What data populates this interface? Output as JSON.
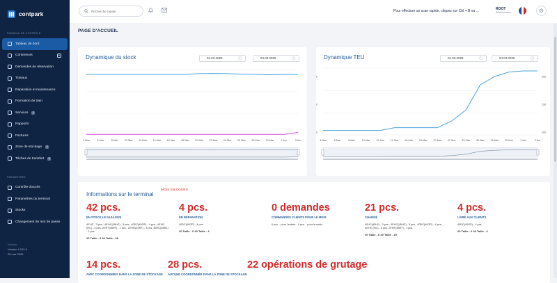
{
  "app": {
    "name": "contpark"
  },
  "sidebar": {
    "section1": "PANNEAU DE CONTRÔLE",
    "items": [
      {
        "label": "Tableau de bord",
        "active": true
      },
      {
        "label": "Conteneurs",
        "plus": true
      },
      {
        "label": "Demandes de réservation"
      },
      {
        "label": "Travaux"
      },
      {
        "label": "Réparation et maintenance"
      },
      {
        "label": "Formation de train"
      },
      {
        "label": "Services",
        "badge": "2"
      },
      {
        "label": "Rapports"
      },
      {
        "label": "Factures"
      },
      {
        "label": "Zone de stockage",
        "badge": "2"
      },
      {
        "label": "Tâches de transfert",
        "badge": "0"
      }
    ],
    "section2": "PARAMÈTRES",
    "settings_items": [
      {
        "label": "Contrôle d'accès"
      },
      {
        "label": "Paramètres du terminal"
      },
      {
        "label": "Stocks"
      },
      {
        "label": "Changement de mot de passe"
      }
    ],
    "footer": {
      "label": "Version",
      "version": "Version 4.102.9",
      "date": "28 mar 2025"
    }
  },
  "topbar": {
    "search_placeholder": "Recherche rapide",
    "notice": "Pour effectuer un scan rapide, cliquez sur Ctrl + B ou ...",
    "user_name": "ROOT",
    "user_role": "Administrateur"
  },
  "page": {
    "title": "PAGE D'ACCUEIL"
  },
  "stock_chart": {
    "title": "Dynamique du stock",
    "date_from": "04.03.2025",
    "date_to": "04.04.2025"
  },
  "teu_chart": {
    "title": "Dynamique TEU",
    "date_from": "04.03.2025",
    "date_to": "04.04.2025"
  },
  "chart_data": [
    {
      "type": "line",
      "title": "Dynamique du stock",
      "x": [
        "4 Mar",
        "6 Mar",
        "8 Mar",
        "10 Mar",
        "12 Mar",
        "14 Mar",
        "16 Mar",
        "18 Mar",
        "20 Mar",
        "22 Mar",
        "24 Mar",
        "26 Mar",
        "28 Mar",
        "30 Mar",
        "1 Avr",
        "3 Avr"
      ],
      "series": [
        {
          "values": [
            37,
            37,
            37,
            37,
            37,
            37,
            37,
            37,
            37.5,
            37.6,
            37.5,
            37.2,
            37,
            36.8,
            37,
            36.9
          ],
          "color": "#4ba3d9"
        },
        {
          "values": [
            0.3,
            0.3,
            0.3,
            0.3,
            0.3,
            0.3,
            0.3,
            0.3,
            0.3,
            0.3,
            0.3,
            0.3,
            0.3,
            0.3,
            0.3,
            1.5
          ],
          "color": "#d64fd2"
        }
      ]
    },
    {
      "type": "line",
      "title": "Dynamique TEU",
      "x": [
        "4 Mar",
        "6 Mar",
        "8 Mar",
        "10 Mar",
        "12 Mar",
        "14 Mar",
        "16 Mar",
        "18 Mar",
        "20 Mar",
        "22 Mar",
        "24 Mar",
        "26 Mar",
        "28 Mar",
        "30 Mar",
        "1 Avr",
        "3 Avr"
      ],
      "y_ticks": [
        "100",
        "150",
        "200"
      ],
      "series": [
        {
          "values": [
            103,
            103,
            103,
            103,
            103,
            108,
            108,
            108,
            108,
            120,
            140,
            185,
            200,
            208,
            210,
            210
          ],
          "color": "#4ba3d9"
        }
      ]
    }
  ],
  "info": {
    "title": "Informations sur le terminal",
    "subtitle": "MOIS EN COURS",
    "stats": [
      {
        "value": "42 pcs.",
        "label": "EN STOCK LE 04.04.2025",
        "detail": "40'HC - 3 pcs., 40'HC(45HC) - 3 pcs., 40DC(40GP) - 4 pcs., 40'HC (HC) - 4 pcs. 20'RT(45RT) - 1 pcs., 20'RE(22RT) - 3 pcs. 45HC(45R1) - 1 pcs.",
        "foot": "20 Taille - 6   40 Taille - 36"
      },
      {
        "value": "4 pcs.",
        "label": "EN RÉPARATION",
        "detail": "40DC(40GP) - 4 pcs.",
        "foot": "20 Taille - 0   40 Taille - 4"
      },
      {
        "value": "0 demandes",
        "label": "COMMANDES CLIENTS POUR LE MOIS",
        "detail": "0 pcs. - pour l'entrée · 0 pcs. - pour la sortie",
        "foot": ""
      },
      {
        "value": "21 pcs.",
        "label": "CHARGÉ",
        "detail": "40HC(45H1) - 3 pcs., 40'HC(45HC) - 3 pcs., 40DC(40GP) - 4 pcs., 40'HC (HC) - 4 pcs. 20'RT(45RT) - 1 pcs.",
        "foot": "20 Taille - 6   40 Taille - 15"
      },
      {
        "value": "4 pcs.",
        "label": "LIVRÉ AUX CLIENTS",
        "detail": "40DC(40GP) - 4 pcs.",
        "foot": "20 Taille - 0   40 Taille - 4"
      },
      {
        "value": "14 pcs.",
        "label": "AVEC COORDONNÉES DANS LA ZONE DE STOCKAGE",
        "detail": "",
        "foot": ""
      },
      {
        "value": "28 pcs.",
        "label": "AUCUNE COORDONNÉE DANS LA ZONE DE STOCKAGE",
        "detail": "",
        "foot": ""
      },
      {
        "value": "22 opérations de grutage",
        "label": "",
        "detail": "",
        "foot": ""
      }
    ]
  }
}
